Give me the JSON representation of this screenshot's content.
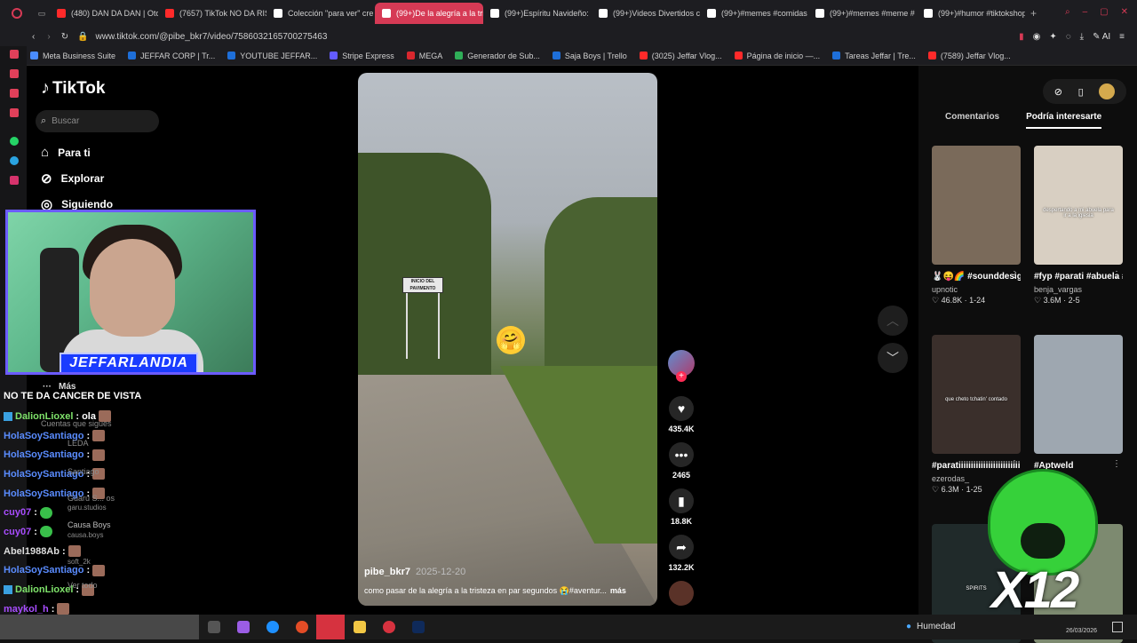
{
  "browser": {
    "tabs": [
      {
        "label": "(480) DAN DA DAN | Oto",
        "color": "#ff2a2a"
      },
      {
        "label": "(7657) TikTok NO DA RIS",
        "color": "#ff2a2a"
      },
      {
        "label": "Colección \"para ver\" cre",
        "color": "#ffffff"
      },
      {
        "label": "(99+)De la alegría a la tris",
        "color": "#ffffff",
        "active": true
      },
      {
        "label": "(99+)Espíritu Navideño:",
        "color": "#ffffff"
      },
      {
        "label": "(99+)Videos Divertidos c",
        "color": "#ffffff"
      },
      {
        "label": "(99+)#memes #comidas",
        "color": "#ffffff"
      },
      {
        "label": "(99+)#memes #meme #",
        "color": "#ffffff"
      },
      {
        "label": "(99+)#humor #tiktokshop",
        "color": "#ffffff"
      }
    ],
    "url": "www.tiktok.com/@pibe_bkr7/video/7586032165700275463",
    "bookmarks": [
      {
        "label": "Meta Business Suite",
        "color": "#4a8cff"
      },
      {
        "label": "JEFFAR CORP | Tr...",
        "color": "#1e6fd9"
      },
      {
        "label": "YOUTUBE JEFFAR...",
        "color": "#1e6fd9"
      },
      {
        "label": "Stripe Express",
        "color": "#635bff"
      },
      {
        "label": "MEGA",
        "color": "#d9272e"
      },
      {
        "label": "Generador de Sub...",
        "color": "#2fae58"
      },
      {
        "label": "Saja Boys | Trello",
        "color": "#1e6fd9"
      },
      {
        "label": "(3025) Jeffar Vlog...",
        "color": "#ff2a2a"
      },
      {
        "label": "Página de inicio —...",
        "color": "#ff2a2a"
      },
      {
        "label": "Tareas Jeffar | Tre...",
        "color": "#1e6fd9"
      },
      {
        "label": "(7589) Jeffar Vlog...",
        "color": "#ff2a2a"
      }
    ],
    "ai_label": "AI"
  },
  "tiktok": {
    "brand": "TikTok",
    "search_placeholder": "Buscar",
    "nav": [
      {
        "label": "Para ti",
        "icon": "home-icon"
      },
      {
        "label": "Explorar",
        "icon": "compass-icon"
      },
      {
        "label": "Siguiendo",
        "icon": "following-icon"
      }
    ],
    "more_label": "Más",
    "video": {
      "author": "pibe_bkr7",
      "date": "2025-12-20",
      "caption": "como pasar de la alegría a la tristeza en par segundos 😭#aventur...",
      "more_link": "más",
      "sign_text": "INICIO DEL PAVIMENTO",
      "emoji": "🤗"
    },
    "actions": {
      "likes": "435.4K",
      "comments": "2465",
      "saves": "18.8K",
      "shares": "132.2K"
    },
    "right_tabs": {
      "comments": "Comentarios",
      "recommended": "Podría interesarte"
    },
    "cards": [
      {
        "title": "🐰😝🌈 #sounddesign...",
        "user": "upnotic",
        "stats": "♡ 46.8K · 1-24",
        "color": "#7a6a5a"
      },
      {
        "title": "#fyp #parati #abuela #viral",
        "user": "benja_vargas",
        "stats": "♡ 3.6M · 2-5",
        "color": "#d8cfc2",
        "thumb_text": "despertando a mi abuela para ir a la iglesia"
      },
      {
        "title": "#paratiiiiiiiiiiiiiiiiiiiiiiiiiiii #novia...",
        "user": "ezerodas_",
        "stats": "♡ 6.3M · 1-25",
        "color": "#3a2f2b",
        "thumb_text": "que cheto tchatin' contado"
      },
      {
        "title": "#Aptweld",
        "user": "",
        "stats": "",
        "color": "#9ea7b0"
      },
      {
        "title": "",
        "user": "",
        "stats": "",
        "color": "#202a2a",
        "thumb_text": "SPIRITS"
      },
      {
        "title": "",
        "user": "",
        "stats": "",
        "color": "#7d8a70"
      }
    ]
  },
  "stream_overlay": {
    "banner": "JEFFARLANDIA",
    "chat_title": "NO TE DA CANCER DE VISTA",
    "chat": [
      {
        "user": "DalionLioxel",
        "text": "ola",
        "color": "#7fe36b",
        "badge": true,
        "emote": "face"
      },
      {
        "user": "HolaSoySantiago",
        "text": "",
        "color": "#5a8cff",
        "emote": "face"
      },
      {
        "user": "HolaSoySantiago",
        "text": "",
        "color": "#5a8cff",
        "emote": "face"
      },
      {
        "user": "HolaSoySantiago",
        "text": "",
        "color": "#5a8cff",
        "emote": "face"
      },
      {
        "user": "HolaSoySantiago",
        "text": "",
        "color": "#5a8cff",
        "emote": "face"
      },
      {
        "user": "cuy07",
        "text": "",
        "color": "#a84dff",
        "emote": "green"
      },
      {
        "user": "cuy07",
        "text": "",
        "color": "#a84dff",
        "emote": "green"
      },
      {
        "user": "Abel1988Ab",
        "text": "",
        "color": "#dddddd",
        "emote": "face"
      },
      {
        "user": "HolaSoySantiago",
        "text": "",
        "color": "#5a8cff",
        "emote": "face"
      },
      {
        "user": "DalionLioxel",
        "text": "",
        "color": "#7fe36b",
        "badge": true,
        "emote": "face"
      },
      {
        "user": "maykol_h",
        "text": "",
        "color": "#a84dff",
        "emote": "face"
      },
      {
        "user": "DalionLioxel",
        "text": "",
        "color": "#7fe36b",
        "badge": true,
        "emote": "face"
      }
    ],
    "ghost_following": "Cuentas que sigues",
    "ghost_accounts": [
      "LEDA",
      "Santiago",
      "Guaru S... os",
      "garu.studios",
      "Causa Boys",
      "causa.boys",
      "soft_2k",
      "Ver todo"
    ],
    "x12_label": "X12"
  },
  "taskbar": {
    "weather": "Humedad",
    "date": "26/03/2026"
  }
}
